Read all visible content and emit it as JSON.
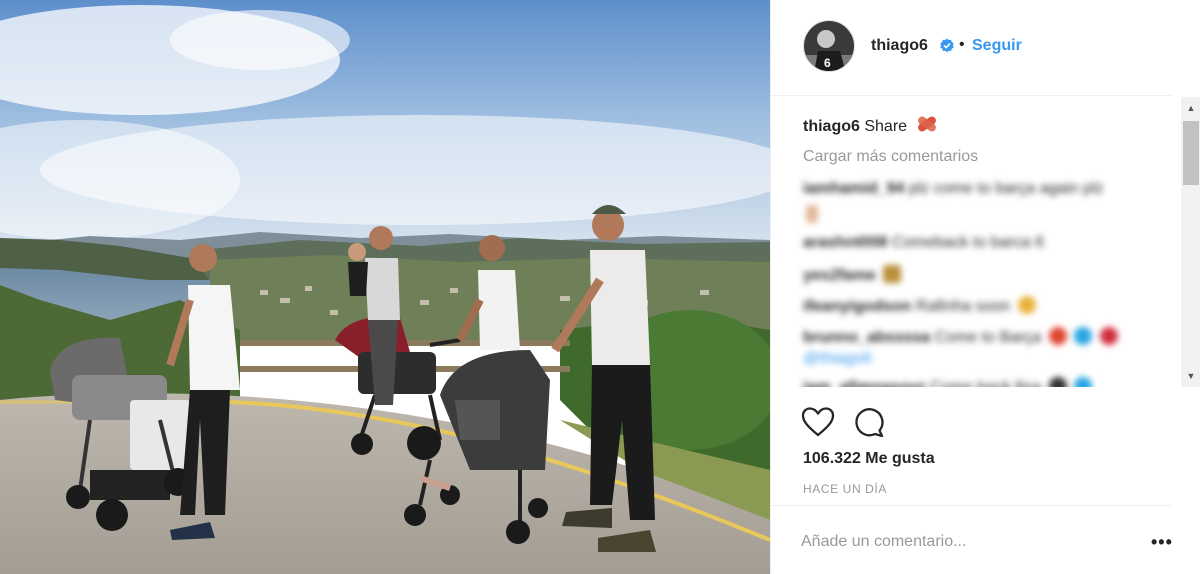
{
  "post": {
    "photo": {
      "kind": "Photo of four men pushing baby strollers on a coastal lookout path",
      "icon": "post-photo"
    },
    "header": {
      "username": "thiago6",
      "verified_icon": "verified-badge-icon",
      "separator": "•",
      "follow_label": "Seguir"
    },
    "caption": {
      "username": "thiago6",
      "text": "Share"
    },
    "load_more_label": "Cargar más comentarios",
    "comments": [
      {
        "user": "iamhamid_94",
        "text": "plz come to barça again plz"
      },
      {
        "user": "",
        "text": ""
      },
      {
        "user": "arashnt008",
        "text": "Comeback to barca 6"
      },
      {
        "user": "yes2fame",
        "text": ""
      },
      {
        "user": "ifeanyigodson",
        "text": "Rafinha soon"
      },
      {
        "user": "brunno_abssssa",
        "text": "Come to Barça"
      },
      {
        "user": "",
        "text": "@thiago6"
      },
      {
        "user": "iam_afimnasour",
        "text": "Come back fina"
      }
    ],
    "likes_text": "106.322 Me gusta",
    "timestamp": "HACE UN DÍA",
    "add_comment_placeholder": "Añade un comentario...",
    "more_label": "•••"
  },
  "colors": {
    "link_blue": "#3897f0",
    "text": "#262626",
    "muted": "#999999",
    "divider": "#efefef"
  }
}
